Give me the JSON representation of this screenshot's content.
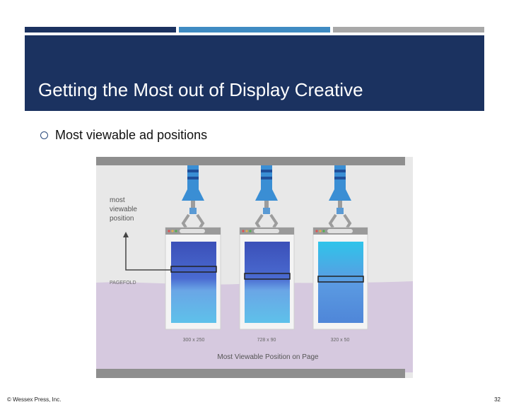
{
  "slide": {
    "title": "Getting the Most out of Display Creative",
    "bullet": "Most viewable ad positions",
    "footer_left": "© Wessex Press, Inc.",
    "page_number": "32"
  },
  "figure": {
    "callout": [
      "most",
      "viewable",
      "position"
    ],
    "fold_label": "PAGEFOLD",
    "ad_sizes": [
      "300 x 250",
      "728 x 90",
      "320 x 50"
    ],
    "caption": "Most Viewable Position on Page"
  },
  "colors": {
    "header": "#1b3260",
    "bar_1": "#1b3260",
    "bar_2": "#3f8bc2",
    "bar_3": "#a8a8a8",
    "below_fold": "#d6c9df",
    "figure_bg": "#e8e8e8"
  }
}
